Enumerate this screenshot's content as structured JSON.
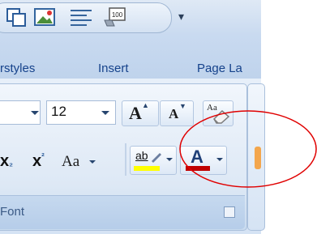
{
  "tabs": {
    "mailings_partial": "rstyles",
    "insert": "Insert",
    "page_layout_partial": "Page La"
  },
  "quick_access": {
    "dropdown_glyph": "▾"
  },
  "font_group": {
    "size_value": "12",
    "label": "Font",
    "grow_glyph": "A",
    "shrink_glyph": "A",
    "clear_glyph": "Aa",
    "subscript": "x",
    "subscript_small": "₂",
    "superscript": "x",
    "superscript_small": "²",
    "case_glyph": "Aa",
    "highlight_glyph": "ab",
    "fontcolor_glyph": "A"
  },
  "colors": {
    "highlight": "#ffff00",
    "font_color": "#c00000",
    "annotation": "#e00000"
  }
}
